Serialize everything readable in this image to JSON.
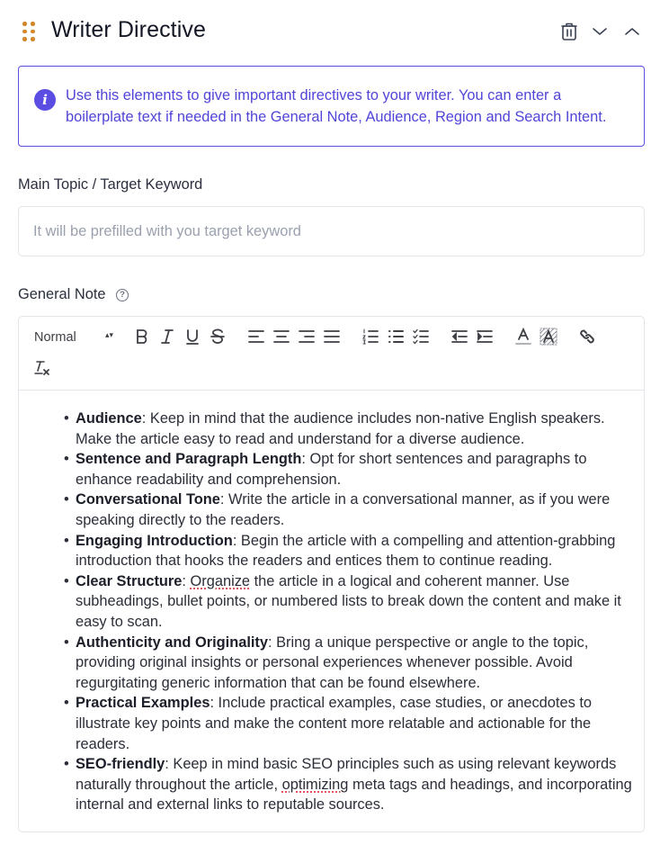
{
  "header": {
    "title": "Writer Directive",
    "icons": [
      "drag-handle-icon",
      "trash-icon",
      "chevron-down-icon",
      "chevron-up-icon"
    ]
  },
  "info": {
    "text": "Use this elements to give important directives to your writer. You can enter a boilerplate text if needed in the General Note, Audience, Region and Search Intent."
  },
  "main_topic": {
    "label": "Main Topic / Target Keyword",
    "value": "",
    "placeholder": "It will be prefilled with you target keyword"
  },
  "general_note": {
    "label": "General Note",
    "help_glyph": "?",
    "toolbar": {
      "format_select": "Normal",
      "buttons": [
        "bold",
        "italic",
        "underline",
        "strike",
        "align-left",
        "align-center",
        "align-right",
        "align-justify",
        "ordered-list",
        "bullet-list",
        "check-list",
        "indent-decrease",
        "indent-increase",
        "text-color",
        "background-color",
        "link",
        "clear-format"
      ]
    },
    "items": [
      {
        "title": "Audience",
        "text": ": Keep in mind that the audience includes non-native English speakers. Make the article easy to read and understand for a diverse audience."
      },
      {
        "title": "Sentence and Paragraph Length",
        "text": ": Opt for short sentences and paragraphs to enhance readability and comprehension."
      },
      {
        "title": "Conversational Tone",
        "text": ": Write the article in a conversational manner, as if you were speaking directly to the readers."
      },
      {
        "title": "Engaging Introduction",
        "text": ": Begin the article with a compelling and attention-grabbing introduction that hooks the readers and entices them to continue reading."
      },
      {
        "title": "Clear Structure",
        "text_pre": ": ",
        "misspelled": "Organize",
        "text": " the article in a logical and coherent manner. Use subheadings, bullet points, or numbered lists to break down the content and make it easy to scan."
      },
      {
        "title": "Authenticity and Originality",
        "text": ": Bring a unique perspective or angle to the topic, providing original insights or personal experiences whenever possible. Avoid regurgitating generic information that can be found elsewhere."
      },
      {
        "title": "Practical Examples",
        "text": ": Include practical examples, case studies, or anecdotes to illustrate key points and make the content more relatable and actionable for the readers."
      },
      {
        "title": "SEO-friendly",
        "text_pre": ": Keep in mind basic SEO principles such as using relevant keywords naturally throughout the article, ",
        "misspelled": "optimizing",
        "text": " meta tags and headings, and incorporating internal and external links to reputable sources."
      }
    ]
  },
  "colors": {
    "accent": "#5b4ce2",
    "drag_handle": "#d3892a",
    "border": "#e3e5ea"
  }
}
